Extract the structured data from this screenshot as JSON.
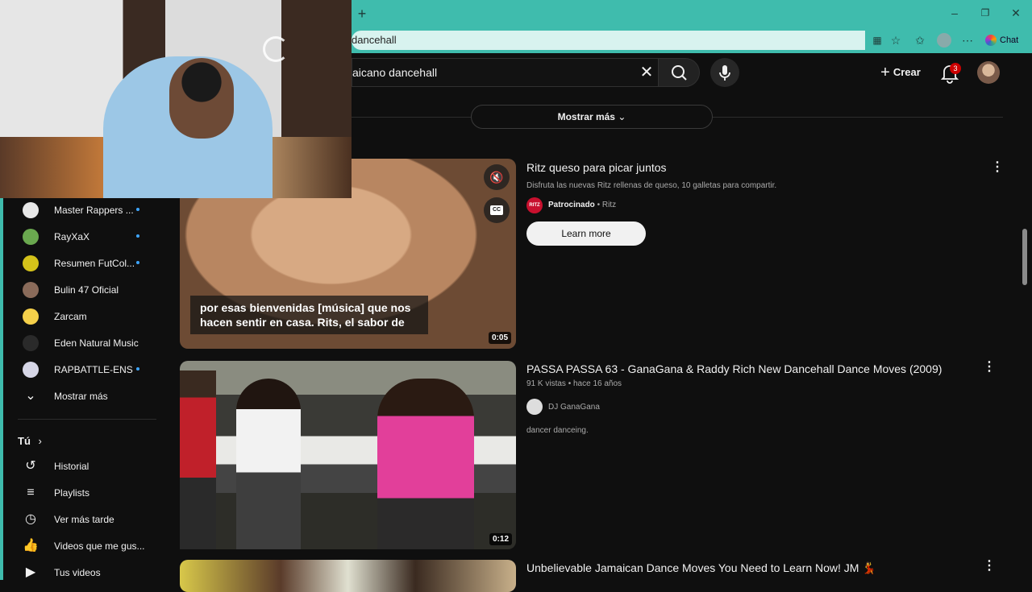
{
  "browser": {
    "new_tab_glyph": "+",
    "url": "dancehall",
    "chat_label": "Chat"
  },
  "header": {
    "search_value": "aicano dancehall",
    "create_label": "Crear",
    "notification_count": "3"
  },
  "results_section": {
    "show_more_label": "Mostrar más"
  },
  "sidebar": {
    "subscriptions": [
      {
        "label": "Master Rappers ...",
        "new": true,
        "color": "#e8e8e8"
      },
      {
        "label": "RayXaX",
        "new": true,
        "color": "#6aa84f"
      },
      {
        "label": "Resumen FutCol...",
        "new": true,
        "color": "#d4c21a"
      },
      {
        "label": "Bulin 47 Oficial",
        "new": false,
        "color": "#8a6b5a"
      },
      {
        "label": "Zarcam",
        "new": false,
        "color": "#f5d04a"
      },
      {
        "label": "Eden Natural Music",
        "new": false,
        "color": "#2a2a2a"
      },
      {
        "label": "RAPBATTLE-ENS",
        "new": true,
        "color": "#d6d6e6"
      }
    ],
    "show_more_label": "Mostrar más",
    "you_label": "Tú",
    "you_items": [
      {
        "label": "Historial",
        "icon": "history-icon"
      },
      {
        "label": "Playlists",
        "icon": "playlists-icon"
      },
      {
        "label": "Ver más tarde",
        "icon": "watch-later-icon"
      },
      {
        "label": "Videos que me gus...",
        "icon": "liked-icon"
      },
      {
        "label": "Tus videos",
        "icon": "your-videos-icon"
      }
    ]
  },
  "ad": {
    "title": "Ritz queso para picar juntos",
    "description": "Disfruta las nuevas Ritz rellenas de queso, 10 galletas para compartir.",
    "sponsored_label": "Patrocinado",
    "advertiser": "Ritz",
    "logo_text": "RITZ",
    "cta_label": "Learn more",
    "caption": "por esas bienvenidas [música] que nos hacen sentir en casa. Rits, el sabor de",
    "duration": "0:05",
    "cc_label": "CC"
  },
  "videos": [
    {
      "title": "PASSA PASSA 63 - GanaGana & Raddy Rich New Dancehall Dance Moves (2009)",
      "views": "91 K vistas",
      "age": "hace 16 años",
      "channel": "DJ GanaGana",
      "description": "dancer danceing.",
      "duration": "0:12"
    },
    {
      "title": "Unbelievable Jamaican Dance Moves You Need to Learn Now! JM 💃"
    }
  ],
  "colors": {
    "browser_accent": "#3fbcad",
    "background": "#0f0f0f",
    "badge": "#cc0000"
  }
}
